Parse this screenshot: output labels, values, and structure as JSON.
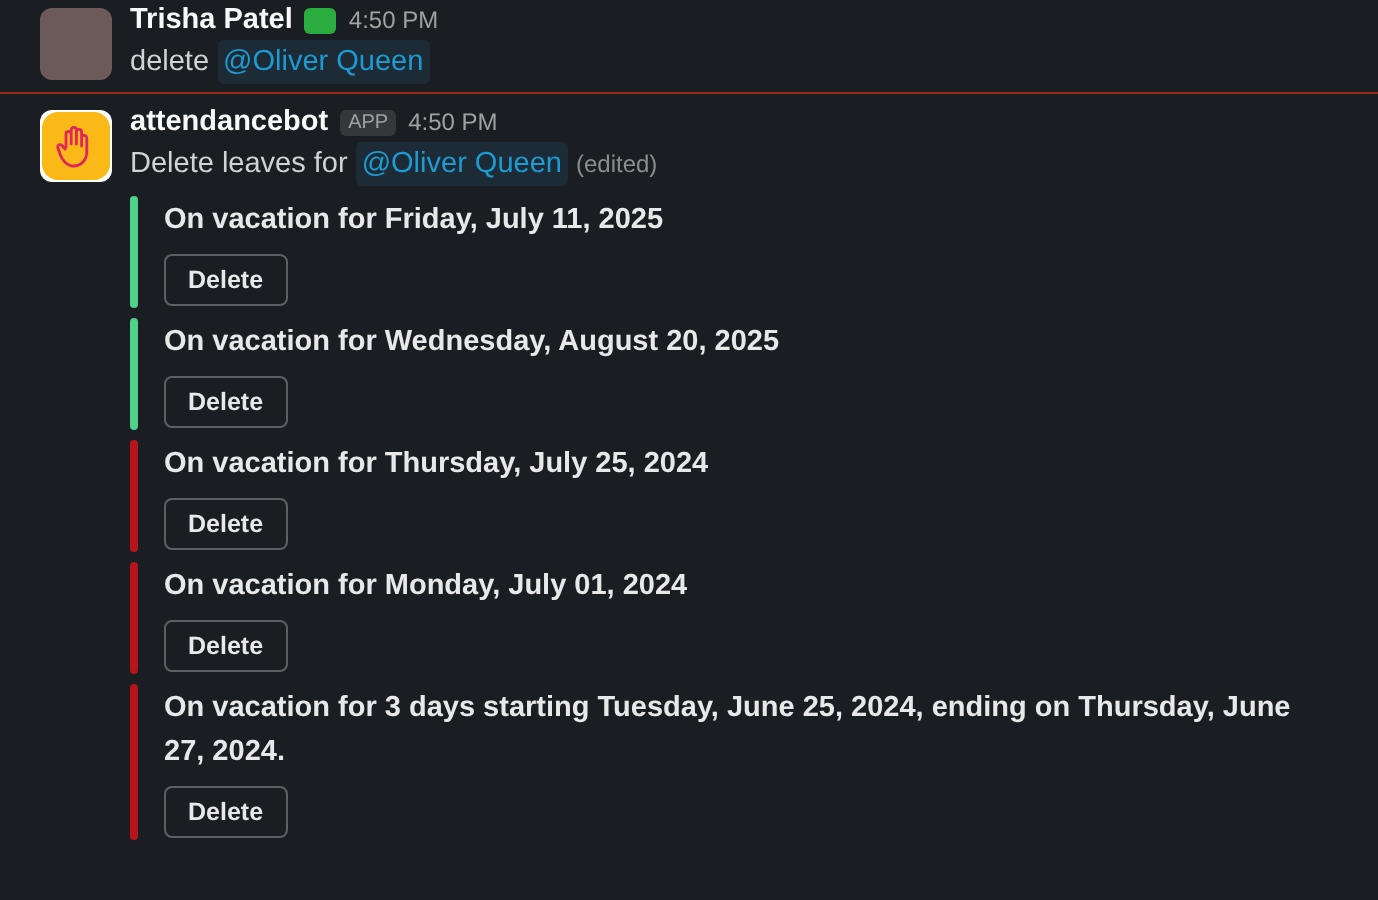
{
  "previous_message": {
    "author": "Trisha Patel",
    "time": "4:50 PM",
    "text": "delete",
    "mention": "@Oliver Queen"
  },
  "message": {
    "author": "attendancebot",
    "badge": "APP",
    "time": "4:50 PM",
    "text": "Delete leaves for",
    "mention": "@Oliver Queen",
    "edited": "(edited)",
    "attachments": [
      {
        "color": "#4fd18b",
        "title": "On vacation for Friday, July 11, 2025",
        "button": "Delete"
      },
      {
        "color": "#4fd18b",
        "title": "On vacation for Wednesday, August 20, 2025",
        "button": "Delete"
      },
      {
        "color": "#b7141c",
        "title": "On vacation for Thursday, July 25, 2024",
        "button": "Delete"
      },
      {
        "color": "#b7141c",
        "title": "On vacation for Monday, July 01, 2024",
        "button": "Delete"
      },
      {
        "color": "#b7141c",
        "title": "On vacation for 3 days starting Tuesday, June 25, 2024, ending on Thursday, June 27, 2024.",
        "button": "Delete"
      }
    ]
  }
}
